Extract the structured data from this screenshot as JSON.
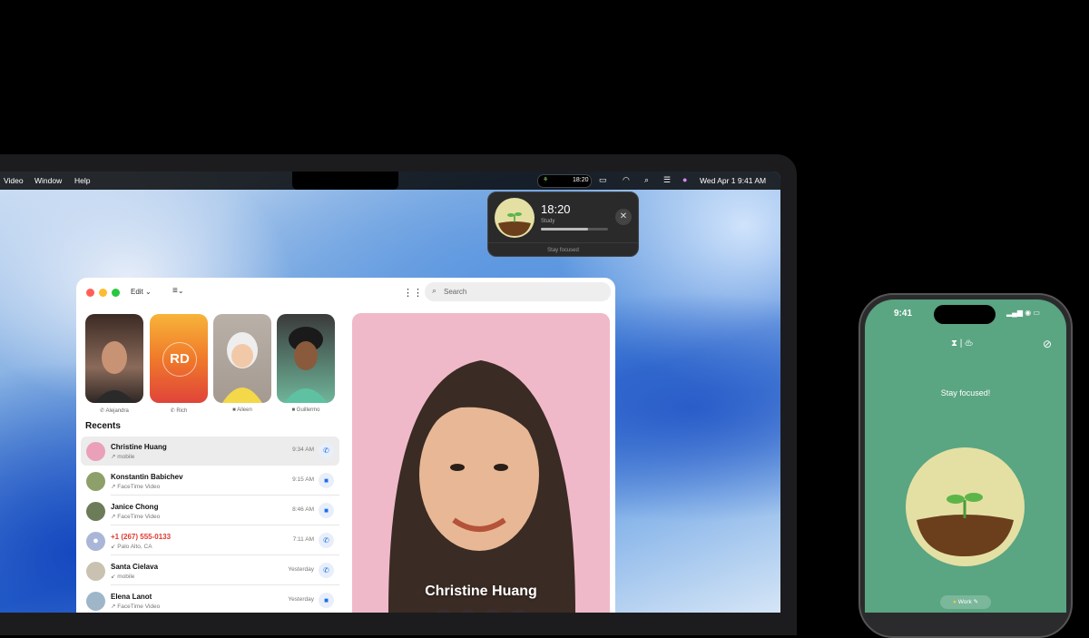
{
  "menubar": {
    "menus": [
      "Video",
      "Window",
      "Help"
    ],
    "focus_pill_time": "18:20",
    "datetime": "Wed Apr 1  9:41 AM",
    "icons": [
      "plant-icon",
      "battery-icon",
      "wifi-icon",
      "search-icon",
      "control-center-icon",
      "siri-icon"
    ]
  },
  "focus_widget": {
    "time": "18:20",
    "label": "Study",
    "progress": 0.7,
    "footer": "Stay focused"
  },
  "facetime": {
    "toolbar": {
      "edit_label": "Edit",
      "filter_icon": "filter-icon",
      "grid_icon": "grid-icon",
      "search_placeholder": "Search"
    },
    "favorites": [
      {
        "name": "Alejandra",
        "type": "phone-icon"
      },
      {
        "name": "Rich",
        "initials": "RD",
        "type": "phone-icon"
      },
      {
        "name": "Aileen",
        "type": "video-icon"
      },
      {
        "name": "Guillermo",
        "type": "video-icon"
      }
    ],
    "recents_title": "Recents",
    "recents": [
      {
        "name": "Christine Huang",
        "sub": "mobile",
        "time": "9:34 AM",
        "action": "phone-icon"
      },
      {
        "name": "Konstantin Babichev",
        "sub": "FaceTime Video",
        "time": "9:15 AM",
        "action": "video-icon"
      },
      {
        "name": "Janice Chong",
        "sub": "FaceTime Video",
        "time": "8:46 AM",
        "action": "video-icon"
      },
      {
        "name": "+1 (267) 555-0133",
        "sub": "Palo Alto, CA",
        "time": "7:11 AM",
        "action": "phone-icon"
      },
      {
        "name": "Santa Cielava",
        "sub": "mobile",
        "time": "Yesterday",
        "action": "phone-icon"
      },
      {
        "name": "Elena Lanot",
        "sub": "FaceTime Video",
        "time": "Yesterday",
        "action": "video-icon"
      }
    ],
    "video": {
      "name": "Christine Huang",
      "buttons": [
        "message-icon",
        "phone-icon",
        "video-icon",
        "mail-icon"
      ]
    }
  },
  "iphone": {
    "time": "9:41",
    "status": "▂▄▆ ◉ ▭",
    "message": "Stay focused!",
    "tag": "Work",
    "tabs": "⧗ | ♨"
  },
  "colors": {
    "accent": "#1a6fe8",
    "phone_bg": "#5aa582",
    "plant_bg": "#e4e0a4",
    "red": "#e0382e"
  }
}
